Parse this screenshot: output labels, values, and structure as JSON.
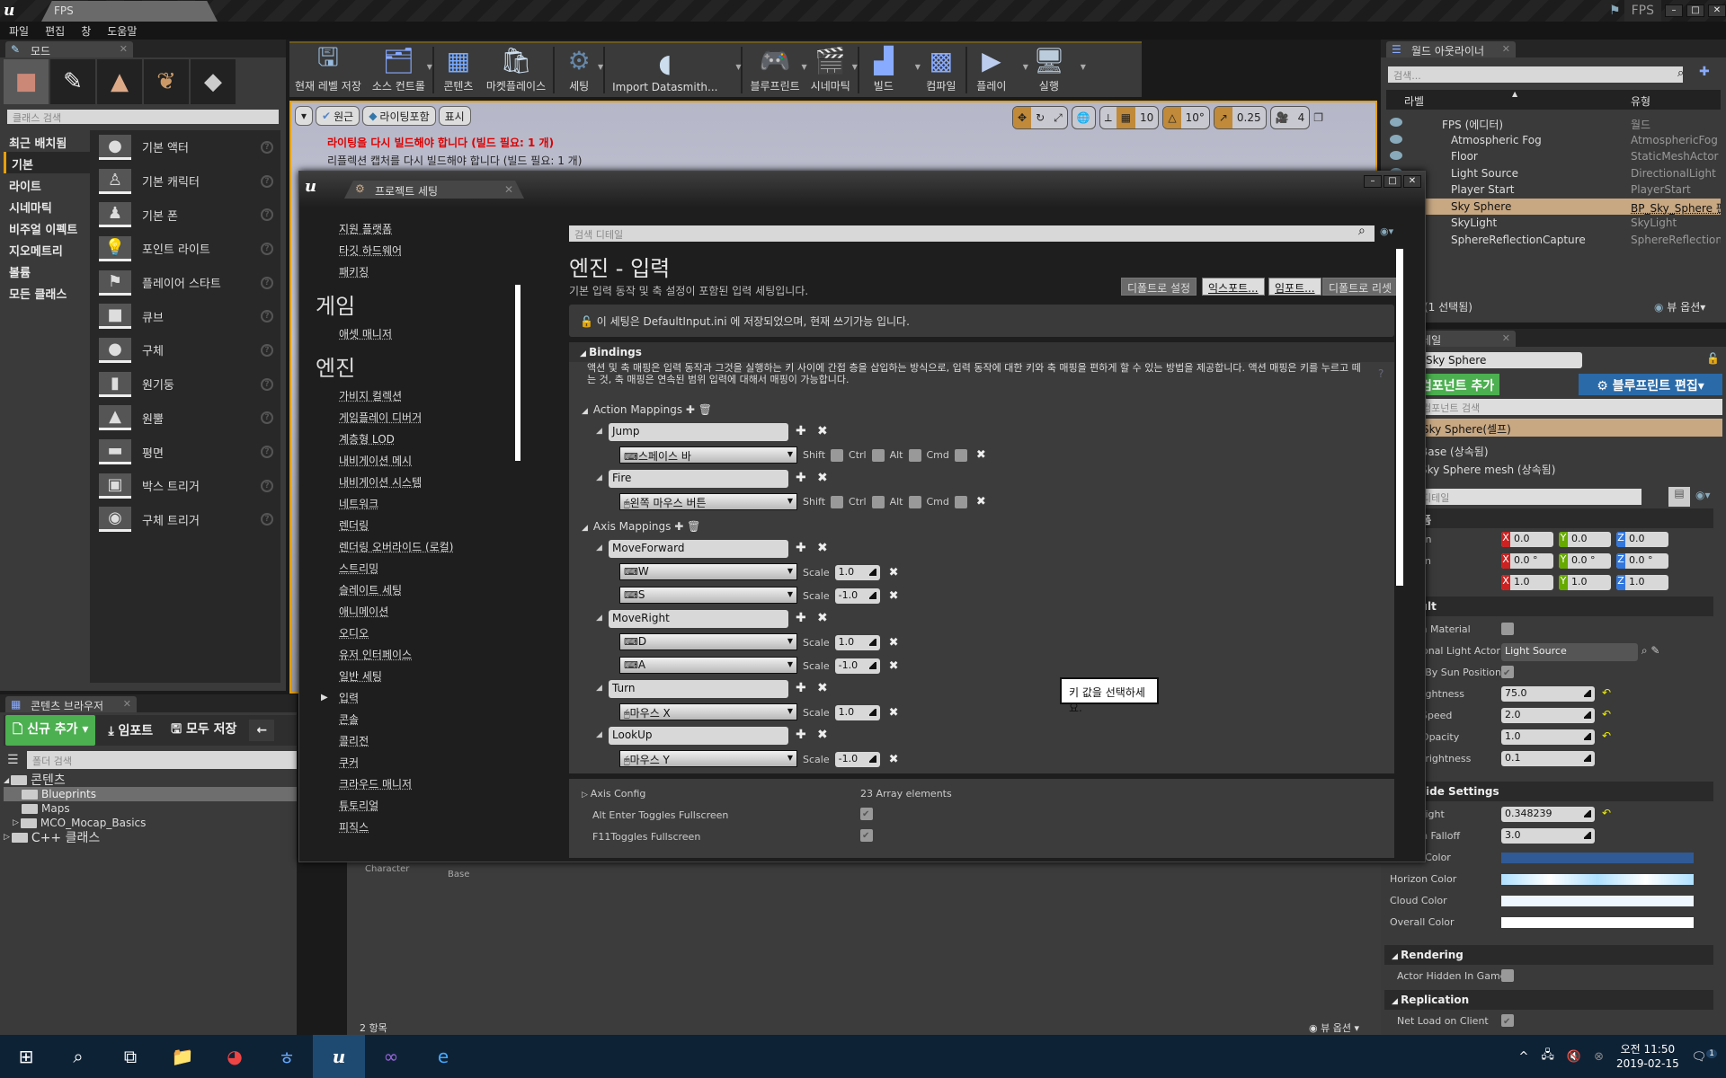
{
  "window": {
    "project_tab": "FPS",
    "title_right": "FPS"
  },
  "menu": [
    "파일",
    "편집",
    "창",
    "도움말"
  ],
  "modes_panel": {
    "tab": "모드",
    "search_placeholder": "클래스 검색",
    "categories": [
      "최근 배치됨",
      "기본",
      "라이트",
      "시네마틱",
      "비주얼 이펙트",
      "지오메트리",
      "볼륨",
      "모든 클래스"
    ],
    "active_category": 1,
    "items": [
      "기본 액터",
      "기본 캐릭터",
      "기본 폰",
      "포인트 라이트",
      "플레이어 스타트",
      "큐브",
      "구체",
      "원기둥",
      "원뿔",
      "평면",
      "박스 트리거",
      "구체 트리거"
    ]
  },
  "toolbar": [
    {
      "label": "현재 레벨 저장",
      "icon": "save-icon"
    },
    {
      "label": "소스 컨트롤",
      "icon": "source-control-icon"
    },
    {
      "label": "콘텐츠",
      "icon": "content-icon"
    },
    {
      "label": "마켓플레이스",
      "icon": "marketplace-icon"
    },
    {
      "label": "세팅",
      "icon": "settings-icon"
    },
    {
      "label": "Import Datasmith...",
      "icon": "datasmith-icon"
    },
    {
      "label": "블루프린트",
      "icon": "blueprint-icon"
    },
    {
      "label": "시네마틱",
      "icon": "cinematic-icon"
    },
    {
      "label": "빌드",
      "icon": "build-icon"
    },
    {
      "label": "컴파일",
      "icon": "compile-icon"
    },
    {
      "label": "플레이",
      "icon": "play-icon"
    },
    {
      "label": "실행",
      "icon": "launch-icon"
    }
  ],
  "viewport": {
    "perspective": "원근",
    "lit": "라이팅포함",
    "show": "표시",
    "warning1": "라이팅을 다시 빌드해야 합니다 (빌드 필요: 1 개)",
    "warning2": "리플렉션 캡처를 다시 빌드해야 합니다 (빌드 필요: 1 개)",
    "grid_snap": "10",
    "rot_snap": "10°",
    "scale_snap": "0.25",
    "cam_speed": "4"
  },
  "outliner": {
    "tab": "월드 아웃라이너",
    "search_placeholder": "검색...",
    "col_label": "라벨",
    "col_type": "유형",
    "rows": [
      {
        "label": "FPS (에디터)",
        "type": "월드"
      },
      {
        "label": "Atmospheric Fog",
        "type": "AtmosphericFog"
      },
      {
        "label": "Floor",
        "type": "StaticMeshActor"
      },
      {
        "label": "Light Source",
        "type": "DirectionalLight"
      },
      {
        "label": "Player Start",
        "type": "PlayerStart"
      },
      {
        "label": "Sky Sphere",
        "type": "BP_Sky_Sphere 편집"
      },
      {
        "label": "SkyLight",
        "type": "SkyLight"
      },
      {
        "label": "SphereReflectionCapture",
        "type": "SphereReflectionCapture"
      }
    ],
    "selected": 5,
    "status": "(1 선택됨)",
    "view_options": "뷰 옵션"
  },
  "details": {
    "tab": "디테일",
    "name": "Sky Sphere",
    "add_component": "컴포넌트 추가",
    "edit_blueprint": "블루프린트 편집",
    "comp_search": "컴포넌트 검색",
    "self": "Sky Sphere(셀프)",
    "comps": [
      "Base (상속됨)",
      "Sky Sphere mesh (상속됨)"
    ],
    "detail_search": "디테일",
    "transform_hdr": "트랜스폼",
    "location": [
      "0.0",
      "0.0",
      "0.0"
    ],
    "rotation": [
      "0.0 °",
      "0.0 °",
      "0.0 °"
    ],
    "scale": [
      "1.0",
      "1.0",
      "1.0"
    ],
    "default_hdr": "Default",
    "props": [
      {
        "name": "Refresh Material",
        "kind": "check",
        "value": false
      },
      {
        "name": "Directional Light Actor",
        "kind": "select",
        "value": "Light Source"
      },
      {
        "name": "Colors Determined By Sun Position",
        "kind": "check",
        "value": true
      },
      {
        "name": "Sun Brightness",
        "kind": "num",
        "value": "75.0",
        "reset": true
      },
      {
        "name": "Cloud Speed",
        "kind": "num",
        "value": "2.0",
        "reset": true
      },
      {
        "name": "Cloud Opacity",
        "kind": "num",
        "value": "1.0",
        "reset": true
      },
      {
        "name": "Stars Brightness",
        "kind": "num",
        "value": "0.1",
        "reset": false
      }
    ],
    "override_hdr": "Override Settings",
    "override": [
      {
        "name": "Sun Height",
        "kind": "num",
        "value": "0.348239",
        "reset": true
      },
      {
        "name": "Horizon Falloff",
        "kind": "num",
        "value": "3.0",
        "reset": false
      },
      {
        "name": "Zenith Color",
        "kind": "color",
        "value": "#2f5a95"
      },
      {
        "name": "Horizon Color",
        "kind": "gradient",
        "value": "#aee0ff"
      },
      {
        "name": "Cloud Color",
        "kind": "color",
        "value": "#eef6ff"
      },
      {
        "name": "Overall Color",
        "kind": "color",
        "value": "#ffffff"
      }
    ],
    "rendering_hdr": "Rendering",
    "actor_hidden": "Actor Hidden In Game",
    "replication_hdr": "Replication",
    "net_load": "Net Load on Client"
  },
  "content_browser": {
    "tab": "콘텐츠 브라우저",
    "add_new": "신규 추가",
    "import": "임포트",
    "save_all": "모두 저장",
    "folder_search": "폴더 검색",
    "tree": [
      {
        "label": "콘텐츠",
        "level": 0
      },
      {
        "label": "Blueprints",
        "level": 1,
        "selected": true
      },
      {
        "label": "Maps",
        "level": 1
      },
      {
        "label": "MCO_Mocap_Basics",
        "level": 1
      },
      {
        "label": "C++ 클래스",
        "level": 0
      }
    ],
    "items_peek": [
      "Character",
      "Base"
    ],
    "count": "2 항목",
    "view_options": "뷰 옵션"
  },
  "project_settings": {
    "tab": "프로젝트 세팅",
    "nav": [
      {
        "type": "item",
        "label": "지원 플랫폼"
      },
      {
        "type": "item",
        "label": "타깃 하드웨어"
      },
      {
        "type": "item",
        "label": "패키징"
      },
      {
        "type": "group",
        "label": "게임"
      },
      {
        "type": "item",
        "label": "애셋 매니저"
      },
      {
        "type": "group",
        "label": "엔진"
      },
      {
        "type": "item",
        "label": "가비지 컬렉션"
      },
      {
        "type": "item",
        "label": "게임플레이 디버거"
      },
      {
        "type": "item",
        "label": "계층형 LOD"
      },
      {
        "type": "item",
        "label": "내비게이션 메시"
      },
      {
        "type": "item",
        "label": "내비게이션 시스템"
      },
      {
        "type": "item",
        "label": "네트워크"
      },
      {
        "type": "item",
        "label": "렌더링"
      },
      {
        "type": "item",
        "label": "렌더링 오버라이드 (로컬)"
      },
      {
        "type": "item",
        "label": "스트리밍"
      },
      {
        "type": "item",
        "label": "슬레이트 세팅"
      },
      {
        "type": "item",
        "label": "애니메이션"
      },
      {
        "type": "item",
        "label": "오디오"
      },
      {
        "type": "item",
        "label": "유저 인터페이스"
      },
      {
        "type": "item",
        "label": "일반 세팅"
      },
      {
        "type": "item",
        "label": "입력",
        "current": true
      },
      {
        "type": "item",
        "label": "콘솔"
      },
      {
        "type": "item",
        "label": "콜리전"
      },
      {
        "type": "item",
        "label": "쿠커"
      },
      {
        "type": "item",
        "label": "크라우드 매니저"
      },
      {
        "type": "item",
        "label": "튜토리얼"
      },
      {
        "type": "item",
        "label": "피직스"
      }
    ],
    "search_placeholder": "검색 디테일",
    "title": "엔진 - 입력",
    "subtitle": "기본 입력 동작 및 축 설정이 포함된 입력 세팅입니다.",
    "buttons": [
      "디폴트로 설정",
      "익스포트...",
      "임포트...",
      "디폴트로 리셋"
    ],
    "notice": "이 세팅은 DefaultInput.ini 에 저장되었으며, 현재 쓰기가능 입니다.",
    "bindings_hdr": "Bindings",
    "bindings_desc": "액션 및 축 매핑은 입력 동작과 그것을 실행하는 키 사이에 간접 층을 삽입하는 방식으로, 입력 동작에 대한 키와 축 매핑을 편하게 할 수 있는 방법을 제공합니다. 액션 매핑은 키를 누르고 떼는 것, 축 매핑은 연속된 범위 입력에 대해서 매핑이 가능합니다.",
    "action_hdr": "Action Mappings",
    "axis_hdr": "Axis Mappings",
    "modifier_labels": [
      "Shift",
      "Ctrl",
      "Alt",
      "Cmd"
    ],
    "scale_label": "Scale",
    "actions": [
      {
        "name": "Jump",
        "keys": [
          {
            "key": "스페이스 바",
            "device": "keyboard"
          }
        ]
      },
      {
        "name": "Fire",
        "keys": [
          {
            "key": "왼쪽 마우스 버튼",
            "device": "mouse"
          }
        ]
      }
    ],
    "axes": [
      {
        "name": "MoveForward",
        "keys": [
          {
            "key": "W",
            "scale": "1.0",
            "device": "keyboard"
          },
          {
            "key": "S",
            "scale": "-1.0",
            "device": "keyboard"
          }
        ]
      },
      {
        "name": "MoveRight",
        "keys": [
          {
            "key": "D",
            "scale": "1.0",
            "device": "keyboard"
          },
          {
            "key": "A",
            "scale": "-1.0",
            "device": "keyboard"
          }
        ]
      },
      {
        "name": "Turn",
        "keys": [
          {
            "key": "마우스 X",
            "scale": "1.0",
            "device": "mouse"
          }
        ]
      },
      {
        "name": "LookUp",
        "keys": [
          {
            "key": "마우스 Y",
            "scale": "-1.0",
            "device": "mouse"
          }
        ]
      }
    ],
    "tooltip": "키 값을 선택하세요.",
    "axis_config": "Axis Config",
    "axis_config_value": "23 Array elements",
    "alt_enter": "Alt Enter Toggles Fullscreen",
    "f11": "F11Toggles Fullscreen"
  },
  "taskbar": {
    "time": "오전 11:50",
    "date": "2019-02-15",
    "notifications": "1"
  }
}
